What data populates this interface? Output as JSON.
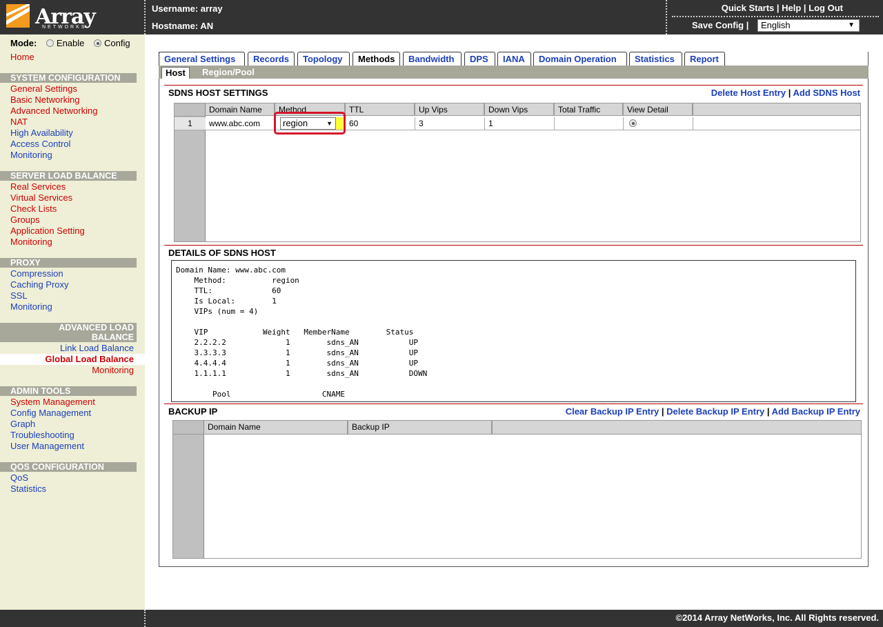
{
  "header": {
    "logo_main": "Array",
    "logo_sub": "NETWORKS",
    "username": "Username: array",
    "hostname": "Hostname: AN",
    "quick_links": "Quick Starts | Help | Log Out",
    "save_config": "Save Config |",
    "language": "English"
  },
  "sidebar": {
    "mode_label": "Mode:",
    "mode_enable": "Enable",
    "mode_config": "Config",
    "home": "Home",
    "sys_title": "SYSTEM CONFIGURATION",
    "sys_items": [
      "General Settings",
      "Basic Networking",
      "Advanced Networking",
      "NAT",
      "High Availability",
      "Access Control",
      "Monitoring"
    ],
    "slb_title": "SERVER LOAD BALANCE",
    "slb_items": [
      "Real Services",
      "Virtual Services",
      "Check Lists",
      "Groups",
      "Application Setting",
      "Monitoring"
    ],
    "proxy_title": "PROXY",
    "proxy_items": [
      "Compression",
      "Caching Proxy",
      "SSL",
      "Monitoring"
    ],
    "alb_title_1": "ADVANCED LOAD",
    "alb_title_2": "BALANCE",
    "alb_items": [
      "Link Load Balance",
      "Global Load Balance",
      "Monitoring"
    ],
    "admin_title": "ADMIN TOOLS",
    "admin_items": [
      "System Management",
      "Config Management",
      "Graph",
      "Troubleshooting",
      "User Management"
    ],
    "qos_title": "QOS CONFIGURATION",
    "qos_items": [
      "QoS",
      "Statistics"
    ]
  },
  "tabs": [
    "General Settings",
    "Records",
    "Topology",
    "Methods",
    "Bandwidth",
    "DPS",
    "IANA",
    "Domain Operation",
    "Statistics",
    "Report"
  ],
  "active_tab": "Methods",
  "subtabs": [
    "Host",
    "Region/Pool"
  ],
  "host_settings": {
    "title": "SDNS HOST SETTINGS",
    "action_delete": "Delete Host Entry",
    "action_add": "Add SDNS Host",
    "columns": [
      "Domain Name",
      "Method",
      "TTL",
      "Up Vips",
      "Down Vips",
      "Total Traffic",
      "View Detail"
    ],
    "rows": [
      {
        "num": "1",
        "domain": "www.abc.com",
        "method": "region",
        "ttl": "60",
        "up_vips": "3",
        "down_vips": "1",
        "total_traffic": ""
      }
    ]
  },
  "details": {
    "title": "DETAILS OF SDNS HOST",
    "text": "Domain Name: www.abc.com\n    Method:          region\n    TTL:             60\n    Is Local:        1\n    VIPs (num = 4)\n\n    VIP            Weight   MemberName        Status\n    2.2.2.2             1        sdns_AN           UP\n    3.3.3.3             1        sdns_AN           UP\n    4.4.4.4             1        sdns_AN           UP\n    1.1.1.1             1        sdns_AN           DOWN\n\n        Pool                    CNAME"
  },
  "backup": {
    "title": "BACKUP IP",
    "action_clear": "Clear Backup IP Entry",
    "action_delete": "Delete Backup IP Entry",
    "action_add": "Add Backup IP Entry",
    "columns": [
      "Domain Name",
      "Backup IP"
    ]
  },
  "footer": {
    "copyright": "©2014 Array NetWorks, Inc. All Rights reserved."
  },
  "colors": {
    "header_bg": "#333333",
    "sidebar_bg": "#efefd7",
    "section_bg": "#a7a79a",
    "link_blue": "#1a3fb8",
    "link_red": "#cc0000",
    "highlight": "#d4152a",
    "logo_orange": "#f39a1e"
  }
}
